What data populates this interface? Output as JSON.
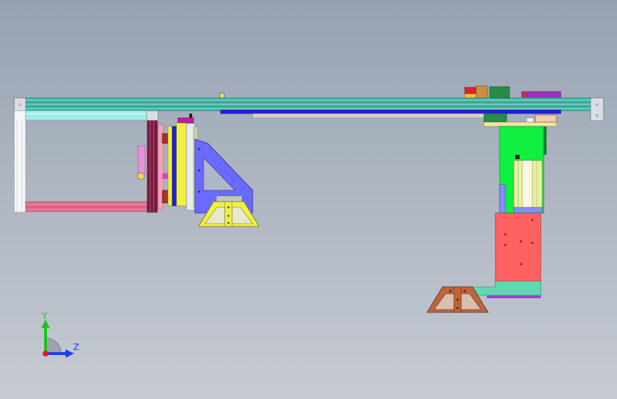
{
  "viewport": {
    "background_top": "#96a2b3",
    "background_bottom": "#c6cbd2"
  },
  "triad": {
    "y_label": "Y",
    "z_label": "Z",
    "y_color": "#18c418",
    "z_color": "#1a3df0",
    "origin_color": "#e01818"
  },
  "colors": {
    "rail_teal": "#3cb4a2",
    "frame_cyan": "#a8f0ec",
    "frame_pink": "#e06a8a",
    "plate_blue": "#6a6aff",
    "bracket_yellow": "#f0f040",
    "column_green": "#10f040",
    "block_red": "#ff6060",
    "base_rust": "#c0643c",
    "slide_blue": "#2020d8"
  }
}
